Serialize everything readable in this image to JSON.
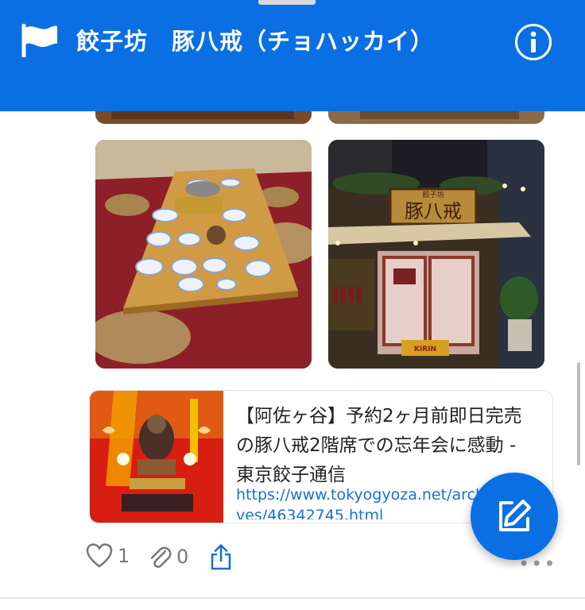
{
  "header": {
    "title": "餃子坊　豚八戒（チョハッカイ）",
    "icon": "flag-icon",
    "info_icon": "info-icon",
    "color": "#0a6fe3"
  },
  "photos": [
    {
      "name": "photo-top-left-partial"
    },
    {
      "name": "photo-top-right-partial"
    },
    {
      "name": "photo-dining-table"
    },
    {
      "name": "photo-restaurant-exterior",
      "sign_text": "豚八戒",
      "sign_small": "餃子坊",
      "lantern": "KIRIN"
    }
  ],
  "link_card": {
    "title": "【阿佐ヶ谷】予約2ヶ月前即日完売の豚八戒2階席での忘年会に感動 - 東京餃子通信",
    "url": "https://www.tokyogyoza.net/archives/46342745.html",
    "thumbnail": "shrine-thumbnail"
  },
  "actions": {
    "likes": "1",
    "attachments": "0",
    "like_icon": "heart-icon",
    "attach_icon": "paperclip-icon",
    "share_icon": "share-icon"
  },
  "more": "•••",
  "fab": {
    "icon": "edit-icon"
  }
}
